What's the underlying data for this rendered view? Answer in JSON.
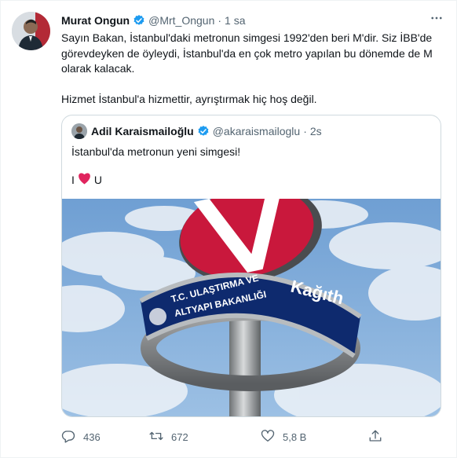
{
  "author": {
    "name": "Murat Ongun",
    "handle": "@Mrt_Ongun",
    "separator": "·",
    "time": "1 sa"
  },
  "more_icon": "more-icon",
  "text": {
    "paragraph1": "Sayın Bakan, İstanbul'daki metronun simgesi 1992'den beri M'dir. Siz İBB'de görevdeyken de öyleydi, İstanbul'da en çok metro yapılan bu dönemde de M olarak kalacak.",
    "paragraph2": "Hizmet İstanbul'a hizmettir, ayrıştırmak hiç hoş değil."
  },
  "quoted": {
    "name": "Adil Karaismailoğlu",
    "handle": "@akaraismailoglu",
    "separator": "·",
    "time": "2s",
    "text": "İstanbul'da metronun yeni simgesi!",
    "line2_prefix": "I",
    "line2_suffix": "U",
    "image": {
      "ring_line1": "T.C. ULAŞTIRMA VE",
      "ring_line2": "ALTYAPI BAKANLIĞI",
      "station_name": "Kağıth"
    }
  },
  "actions": {
    "reply_count": "436",
    "retweet_count": "672",
    "like_count": "5,8 B"
  },
  "colors": {
    "verified": "#1d9bf0",
    "heart": "#e0245e",
    "secondary_text": "#536471",
    "border": "#cfd9de"
  }
}
